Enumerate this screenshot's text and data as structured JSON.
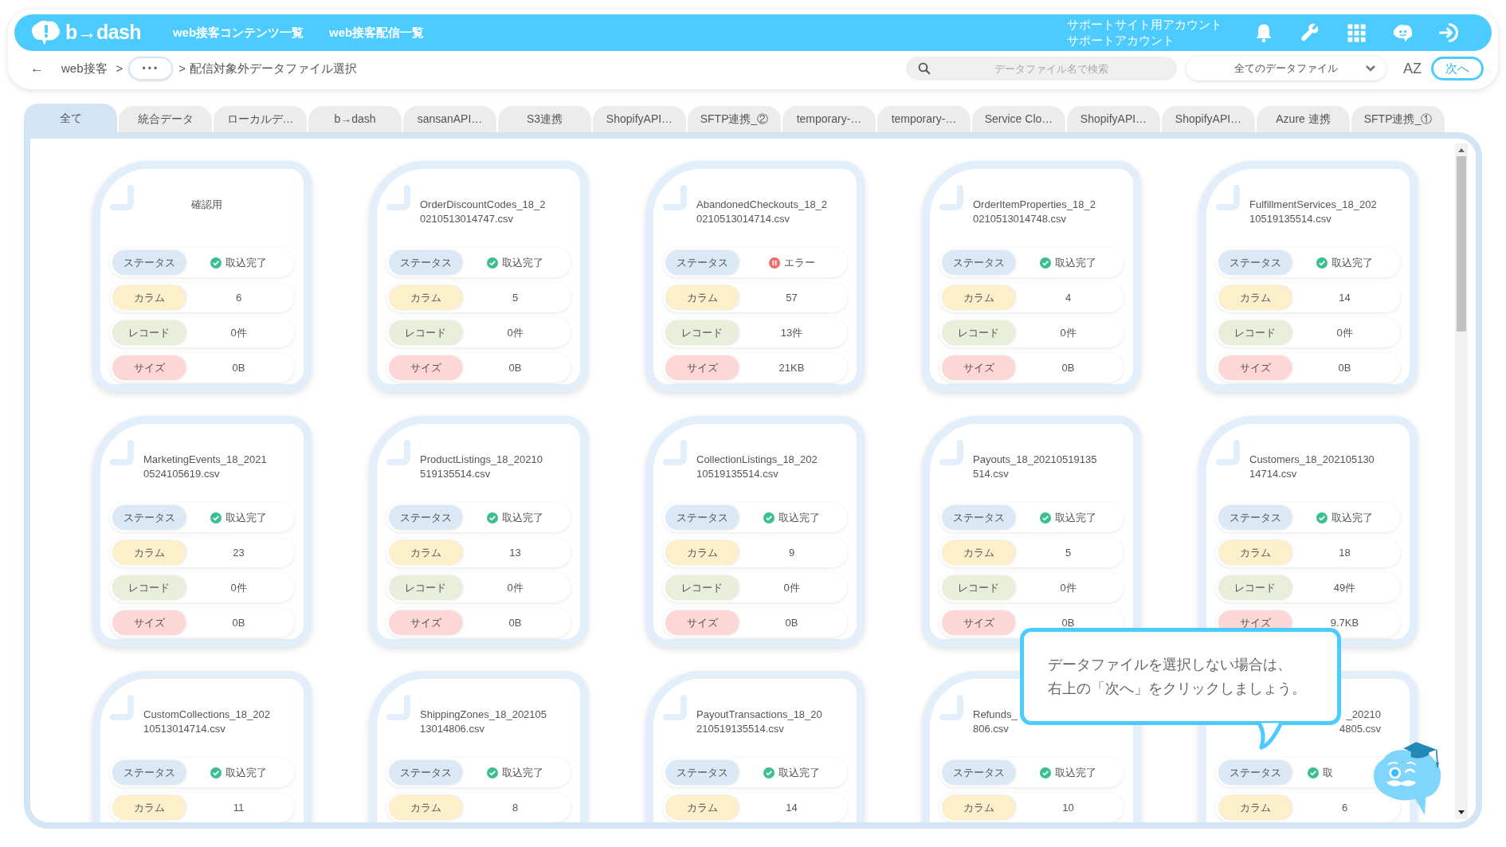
{
  "header": {
    "logo": "b→dash",
    "nav": [
      "web接客コンテンツ一覧",
      "web接客配信一覧"
    ],
    "account": [
      "サポートサイト用アカウント",
      "サポートアカウント"
    ]
  },
  "breadcrumb": [
    {
      "kind": "back",
      "text": "←"
    },
    {
      "kind": "link",
      "text": "web接客"
    },
    {
      "kind": "sep",
      "text": ">"
    },
    {
      "kind": "more",
      "text": "•••"
    },
    {
      "kind": "sep",
      "text": ">"
    },
    {
      "kind": "current",
      "text": "配信対象外データファイル選択"
    }
  ],
  "search": {
    "placeholder": "データファイル名で検索"
  },
  "filter": {
    "value": "全てのデータファイル"
  },
  "sort": "AZ",
  "next_button": "次へ",
  "tabs": [
    {
      "label": "全て",
      "selected": true
    },
    {
      "label": "統合データ",
      "selected": false
    },
    {
      "label": "ローカルデ…",
      "selected": false
    },
    {
      "label": "b→dash",
      "selected": false
    },
    {
      "label": "sansanAPI…",
      "selected": false
    },
    {
      "label": "S3連携",
      "selected": false
    },
    {
      "label": "ShopifyAPI…",
      "selected": false
    },
    {
      "label": "SFTP連携_②",
      "selected": false
    },
    {
      "label": "temporary-…",
      "selected": false
    },
    {
      "label": "temporary-…",
      "selected": false
    },
    {
      "label": "Service Clo…",
      "selected": false
    },
    {
      "label": "ShopifyAPI…",
      "selected": false
    },
    {
      "label": "ShopifyAPI…",
      "selected": false
    },
    {
      "label": "Azure 連携",
      "selected": false
    },
    {
      "label": "SFTP連携_①",
      "selected": false
    }
  ],
  "cards": [
    {
      "title": [
        "確認用"
      ],
      "fields": [
        {
          "kind": "status",
          "label": "ステータス",
          "value": "取込完了",
          "error": false
        },
        {
          "kind": "column",
          "label": "カラム",
          "value": "6"
        },
        {
          "kind": "record",
          "label": "レコード",
          "value": "0件"
        },
        {
          "kind": "size",
          "label": "サイズ",
          "value": "0B"
        }
      ]
    },
    {
      "title": [
        "OrderDiscountCodes_18_2",
        "0210513014747.csv"
      ],
      "fields": [
        {
          "kind": "status",
          "label": "ステータス",
          "value": "取込完了",
          "error": false
        },
        {
          "kind": "column",
          "label": "カラム",
          "value": "5"
        },
        {
          "kind": "record",
          "label": "レコード",
          "value": "0件"
        },
        {
          "kind": "size",
          "label": "サイズ",
          "value": "0B"
        }
      ]
    },
    {
      "title": [
        "AbandonedCheckouts_18_2",
        "0210513014714.csv"
      ],
      "fields": [
        {
          "kind": "status",
          "label": "ステータス",
          "value": "エラー",
          "error": true
        },
        {
          "kind": "column",
          "label": "カラム",
          "value": "57"
        },
        {
          "kind": "record",
          "label": "レコード",
          "value": "13件"
        },
        {
          "kind": "size",
          "label": "サイズ",
          "value": "21KB"
        }
      ]
    },
    {
      "title": [
        "OrderItemProperties_18_2",
        "0210513014748.csv"
      ],
      "fields": [
        {
          "kind": "status",
          "label": "ステータス",
          "value": "取込完了",
          "error": false
        },
        {
          "kind": "column",
          "label": "カラム",
          "value": "4"
        },
        {
          "kind": "record",
          "label": "レコード",
          "value": "0件"
        },
        {
          "kind": "size",
          "label": "サイズ",
          "value": "0B"
        }
      ]
    },
    {
      "title": [
        "FulfillmentServices_18_202",
        "10519135514.csv"
      ],
      "fields": [
        {
          "kind": "status",
          "label": "ステータス",
          "value": "取込完了",
          "error": false
        },
        {
          "kind": "column",
          "label": "カラム",
          "value": "14"
        },
        {
          "kind": "record",
          "label": "レコード",
          "value": "0件"
        },
        {
          "kind": "size",
          "label": "サイズ",
          "value": "0B"
        }
      ]
    },
    {
      "title": [
        "MarketingEvents_18_2021",
        "0524105619.csv"
      ],
      "fields": [
        {
          "kind": "status",
          "label": "ステータス",
          "value": "取込完了",
          "error": false
        },
        {
          "kind": "column",
          "label": "カラム",
          "value": "23"
        },
        {
          "kind": "record",
          "label": "レコード",
          "value": "0件"
        },
        {
          "kind": "size",
          "label": "サイズ",
          "value": "0B"
        }
      ]
    },
    {
      "title": [
        "ProductListings_18_20210",
        "519135514.csv"
      ],
      "fields": [
        {
          "kind": "status",
          "label": "ステータス",
          "value": "取込完了",
          "error": false
        },
        {
          "kind": "column",
          "label": "カラム",
          "value": "13"
        },
        {
          "kind": "record",
          "label": "レコード",
          "value": "0件"
        },
        {
          "kind": "size",
          "label": "サイズ",
          "value": "0B"
        }
      ]
    },
    {
      "title": [
        "CollectionListings_18_202",
        "10519135514.csv"
      ],
      "fields": [
        {
          "kind": "status",
          "label": "ステータス",
          "value": "取込完了",
          "error": false
        },
        {
          "kind": "column",
          "label": "カラム",
          "value": "9"
        },
        {
          "kind": "record",
          "label": "レコード",
          "value": "0件"
        },
        {
          "kind": "size",
          "label": "サイズ",
          "value": "0B"
        }
      ]
    },
    {
      "title": [
        "Payouts_18_20210519135",
        "514.csv"
      ],
      "fields": [
        {
          "kind": "status",
          "label": "ステータス",
          "value": "取込完了",
          "error": false
        },
        {
          "kind": "column",
          "label": "カラム",
          "value": "5"
        },
        {
          "kind": "record",
          "label": "レコード",
          "value": "0件"
        },
        {
          "kind": "size",
          "label": "サイズ",
          "value": "0B"
        }
      ]
    },
    {
      "title": [
        "Customers_18_202105130",
        "14714.csv"
      ],
      "fields": [
        {
          "kind": "status",
          "label": "ステータス",
          "value": "取込完了",
          "error": false
        },
        {
          "kind": "column",
          "label": "カラム",
          "value": "18"
        },
        {
          "kind": "record",
          "label": "レコード",
          "value": "49件"
        },
        {
          "kind": "size",
          "label": "サイズ",
          "value": "9.7KB"
        }
      ]
    },
    {
      "title": [
        "CustomCollections_18_202",
        "10513014714.csv"
      ],
      "fields": [
        {
          "kind": "status",
          "label": "ステータス",
          "value": "取込完了",
          "error": false
        },
        {
          "kind": "column",
          "label": "カラム",
          "value": "11"
        }
      ]
    },
    {
      "title": [
        "ShippingZones_18_202105",
        "13014806.csv"
      ],
      "fields": [
        {
          "kind": "status",
          "label": "ステータス",
          "value": "取込完了",
          "error": false
        },
        {
          "kind": "column",
          "label": "カラム",
          "value": "8"
        }
      ]
    },
    {
      "title": [
        "PayoutTransactions_18_20",
        "210519135514.csv"
      ],
      "fields": [
        {
          "kind": "status",
          "label": "ステータス",
          "value": "取込完了",
          "error": false
        },
        {
          "kind": "column",
          "label": "カラム",
          "value": "14"
        }
      ]
    },
    {
      "title": [
        "Refunds_",
        "806.csv"
      ],
      "fields": [
        {
          "kind": "status",
          "label": "ステータス",
          "value": "取込完了",
          "error": false
        },
        {
          "kind": "column",
          "label": "カラム",
          "value": "10"
        }
      ]
    },
    {
      "title": [
        "_20210",
        "4805.csv"
      ],
      "partly_covered": true,
      "fields": [
        {
          "kind": "status",
          "label": "ステータス",
          "value": "取",
          "error": false
        },
        {
          "kind": "column",
          "label": "カラム",
          "value": "6"
        }
      ]
    }
  ],
  "tooltip": [
    "データファイルを選択しない場合は、",
    "右上の「次へ」をクリックしましょう。"
  ]
}
